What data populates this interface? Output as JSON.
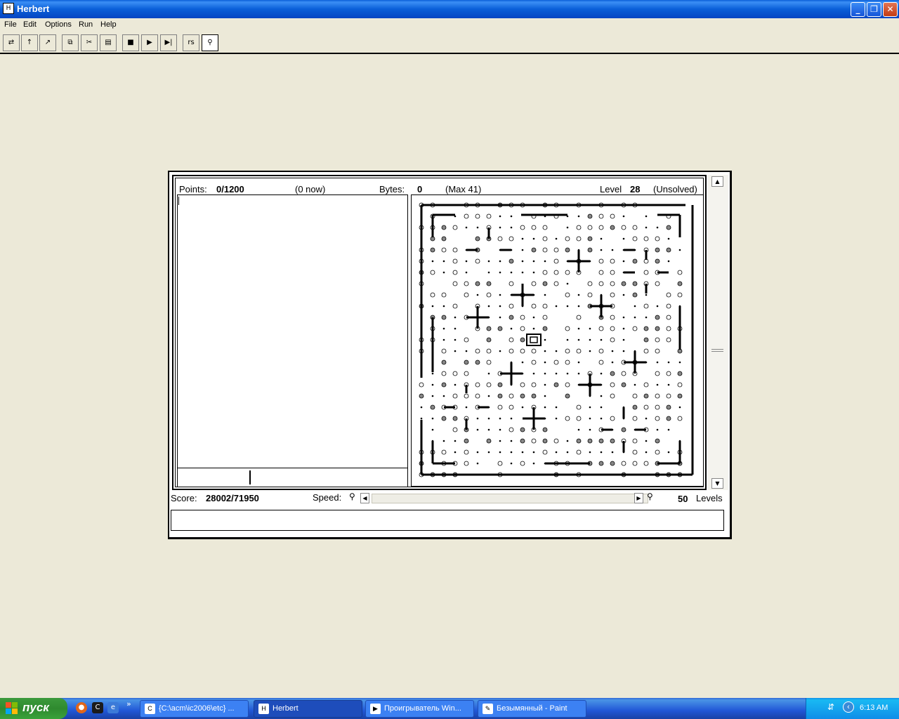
{
  "window": {
    "title": "Herbert",
    "app_icon": "herbert-icon"
  },
  "menu": [
    "File",
    "Edit",
    "Options",
    "Run",
    "Help"
  ],
  "toolbar": {
    "buttons": [
      {
        "name": "open-level-button",
        "glyph": "⇄"
      },
      {
        "name": "load-button",
        "glyph": "↑"
      },
      {
        "name": "save-button",
        "glyph": "↗"
      },
      {
        "name": "copy-button",
        "glyph": "⧉"
      },
      {
        "name": "cut-button",
        "glyph": "✂"
      },
      {
        "name": "paste-button",
        "glyph": "📋"
      },
      {
        "name": "stop-button",
        "glyph": "■"
      },
      {
        "name": "run-button",
        "glyph": "▶"
      },
      {
        "name": "step-button",
        "glyph": "▶|"
      },
      {
        "name": "show-source-button",
        "glyph": "rs"
      },
      {
        "name": "herbert-view-button",
        "glyph": "⚲"
      }
    ]
  },
  "stats": {
    "points_label": "Points:",
    "points": "0/1200",
    "now": "(0 now)",
    "bytes_label": "Bytes:",
    "bytes": "0",
    "max": "(Max 41)",
    "level_label": "Level",
    "level": "28",
    "status": "(Unsolved)",
    "score_label": "Score:",
    "score": "28002/71950",
    "speed_label": "Speed:",
    "levels_count": "50",
    "levels_label": "Levels"
  },
  "editor": {
    "code": "",
    "input": ""
  },
  "message": "",
  "taskbar": {
    "start": "пуск",
    "tasks": [
      {
        "name": "task-explorer",
        "icon": "cmd-icon",
        "label": "{C:\\acm\\ic2006\\etc} ...",
        "active": false
      },
      {
        "name": "task-herbert",
        "icon": "herbert-icon",
        "label": "Herbert",
        "active": true
      },
      {
        "name": "task-player",
        "icon": "media-player-icon",
        "label": "Проигрыватель Win...",
        "active": false
      },
      {
        "name": "task-paint",
        "icon": "paint-icon",
        "label": "Безымянный - Paint",
        "active": false
      }
    ],
    "lang": "EN",
    "time": "6:13 AM"
  }
}
